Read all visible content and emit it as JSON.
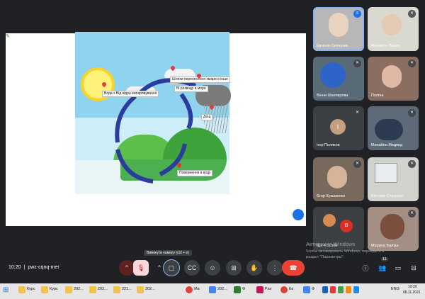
{
  "meeting": {
    "time": "10:20",
    "separator": "|",
    "code": "pwz-cqnq-mer"
  },
  "presentation": {
    "labels": [
      "Вода з Від відра випаровування",
      "Шляхи перенесення хмари в інше",
      "Ві розводу в мора",
      "Дощ",
      "Повернення в воду"
    ]
  },
  "participants": [
    {
      "name": "Евгенія Сипчуник",
      "speaking": true
    },
    {
      "name": "Михайло Пацер"
    },
    {
      "name": "Вінни Шаховрова"
    },
    {
      "name": "Поліна"
    },
    {
      "name": "Ігор Поляков",
      "avatar_letter": "І"
    },
    {
      "name": "Михайло Медвед"
    },
    {
      "name": "Єгор Кузьменко"
    },
    {
      "name": "Вікторія Стаценко"
    },
    {
      "name": "Ще 4 особи",
      "avatar_letter": "В"
    },
    {
      "name": "Марина Балуш"
    }
  ],
  "tooltip": "Вимкнути камеру (ctrl + e)",
  "watermark": {
    "line1": "Активация Windows",
    "line2": "Чтобы активировать Windows, перейдите в",
    "line3": "раздел \"Параметры\"."
  },
  "participants_count": "11",
  "taskbar": {
    "items": [
      "Курс",
      "Курс",
      "202...",
      "202...",
      "221...",
      "202...",
      "Ma",
      "202...",
      "Ф",
      "Pav",
      "Ка",
      "Ф"
    ],
    "lang": "ENG",
    "clock_time": "10:20",
    "clock_date": "08.11.2021"
  },
  "colors": {
    "bg": "#202124",
    "tile": "#3c4043",
    "accent": "#1a73e8",
    "end_call": "#ea4335",
    "mic_off": "#f8d7da"
  },
  "icons": [
    "more-icon",
    "mic-off-icon",
    "chevron-up-icon",
    "camera-icon",
    "captions-icon",
    "emoji-icon",
    "present-icon",
    "hand-icon",
    "more-vertical-icon",
    "end-call-icon",
    "info-icon",
    "people-icon",
    "chat-icon",
    "activities-icon",
    "windows-start-icon",
    "search-icon",
    "folder-icon",
    "chrome-icon",
    "edit-icon"
  ]
}
